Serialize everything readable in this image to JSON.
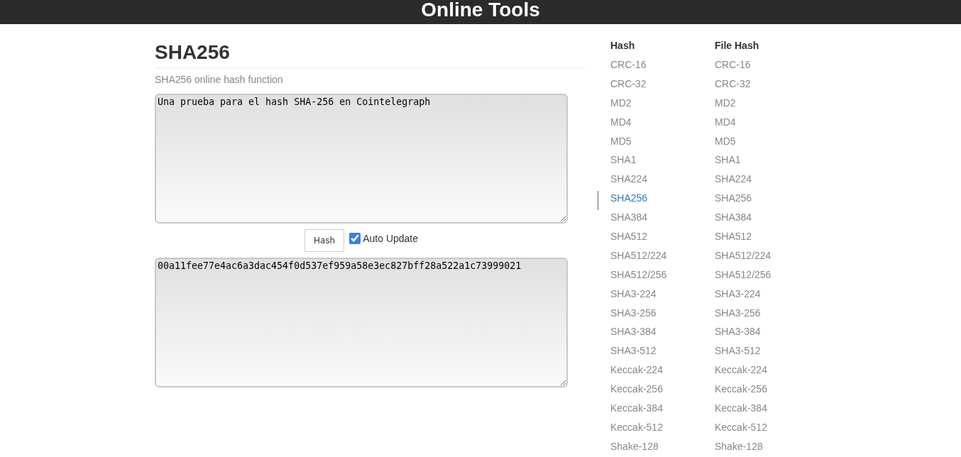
{
  "header": {
    "title": "Online Tools"
  },
  "page": {
    "title": "SHA256",
    "subtitle": "SHA256 online hash function"
  },
  "input": {
    "value": "Una prueba para el hash SHA-256 en Cointelegraph"
  },
  "hash_button": "Hash",
  "auto_update": {
    "label": "Auto Update",
    "checked": true
  },
  "output": {
    "value": "00a11fee77e4ac6a3dac454f0d537ef959a58e3ec827bff28a522a1c73999021"
  },
  "sidebar": [
    {
      "heading": "Hash",
      "items": [
        {
          "label": "CRC-16",
          "selected": false
        },
        {
          "label": "CRC-32",
          "selected": false
        },
        {
          "label": "MD2",
          "selected": false
        },
        {
          "label": "MD4",
          "selected": false
        },
        {
          "label": "MD5",
          "selected": false
        },
        {
          "label": "SHA1",
          "selected": false
        },
        {
          "label": "SHA224",
          "selected": false
        },
        {
          "label": "SHA256",
          "selected": true
        },
        {
          "label": "SHA384",
          "selected": false
        },
        {
          "label": "SHA512",
          "selected": false
        },
        {
          "label": "SHA512/224",
          "selected": false
        },
        {
          "label": "SHA512/256",
          "selected": false
        },
        {
          "label": "SHA3-224",
          "selected": false
        },
        {
          "label": "SHA3-256",
          "selected": false
        },
        {
          "label": "SHA3-384",
          "selected": false
        },
        {
          "label": "SHA3-512",
          "selected": false
        },
        {
          "label": "Keccak-224",
          "selected": false
        },
        {
          "label": "Keccak-256",
          "selected": false
        },
        {
          "label": "Keccak-384",
          "selected": false
        },
        {
          "label": "Keccak-512",
          "selected": false
        },
        {
          "label": "Shake-128",
          "selected": false
        }
      ]
    },
    {
      "heading": "File Hash",
      "items": [
        {
          "label": "CRC-16",
          "selected": false
        },
        {
          "label": "CRC-32",
          "selected": false
        },
        {
          "label": "MD2",
          "selected": false
        },
        {
          "label": "MD4",
          "selected": false
        },
        {
          "label": "MD5",
          "selected": false
        },
        {
          "label": "SHA1",
          "selected": false
        },
        {
          "label": "SHA224",
          "selected": false
        },
        {
          "label": "SHA256",
          "selected": false
        },
        {
          "label": "SHA384",
          "selected": false
        },
        {
          "label": "SHA512",
          "selected": false
        },
        {
          "label": "SHA512/224",
          "selected": false
        },
        {
          "label": "SHA512/256",
          "selected": false
        },
        {
          "label": "SHA3-224",
          "selected": false
        },
        {
          "label": "SHA3-256",
          "selected": false
        },
        {
          "label": "SHA3-384",
          "selected": false
        },
        {
          "label": "SHA3-512",
          "selected": false
        },
        {
          "label": "Keccak-224",
          "selected": false
        },
        {
          "label": "Keccak-256",
          "selected": false
        },
        {
          "label": "Keccak-384",
          "selected": false
        },
        {
          "label": "Keccak-512",
          "selected": false
        },
        {
          "label": "Shake-128",
          "selected": false
        }
      ]
    }
  ]
}
